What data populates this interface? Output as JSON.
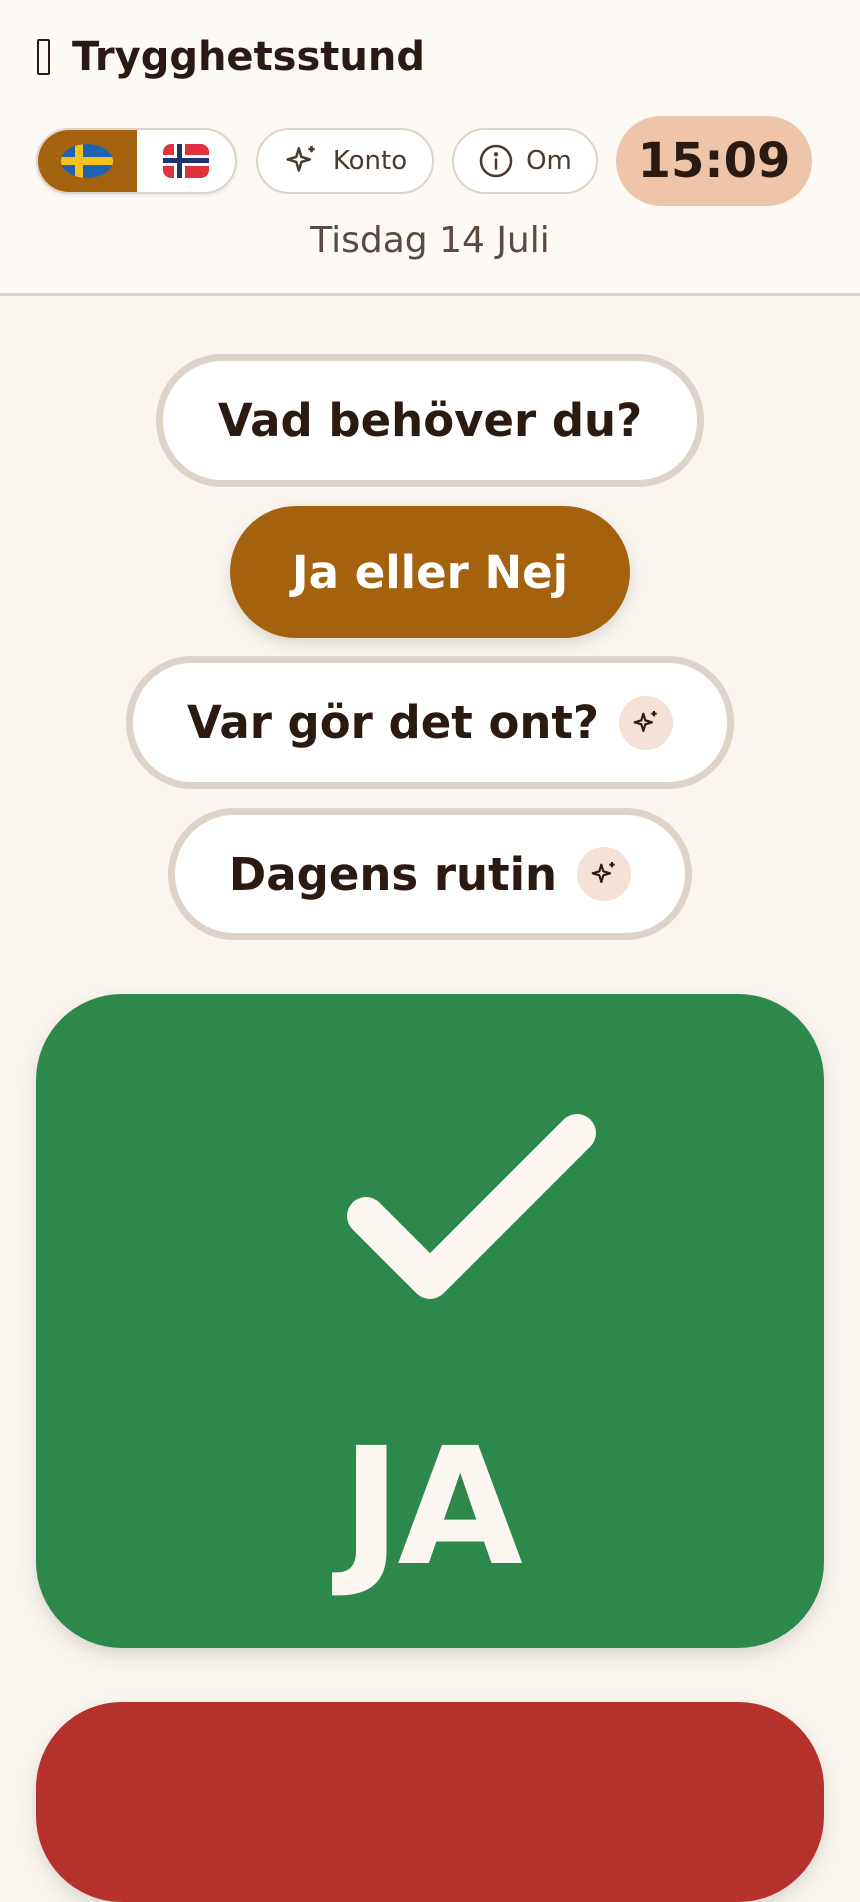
{
  "header": {
    "app_title": "Trygghetsstund",
    "languages": [
      {
        "code": "sv",
        "label": "Svenska",
        "active": true
      },
      {
        "code": "no",
        "label": "Norsk",
        "active": false
      }
    ],
    "account_label": "Konto",
    "about_label": "Om",
    "time": "15:09",
    "date": "Tisdag 14 Juli"
  },
  "modes": [
    {
      "label": "Vad behöver du?",
      "active": false,
      "ai": false
    },
    {
      "label": "Ja eller Nej",
      "active": true,
      "ai": false
    },
    {
      "label": "Var gör det ont?",
      "active": false,
      "ai": true
    },
    {
      "label": "Dagens rutin",
      "active": false,
      "ai": true
    }
  ],
  "answers": {
    "yes_label": "JA",
    "no_label": ""
  },
  "colors": {
    "accent": "#A4620F",
    "yes": "#2D894B",
    "no": "#B5312C",
    "clock_bg": "#EFC5AA",
    "background": "#FAF5EE"
  },
  "icons": {
    "title": "app-icon",
    "account": "sparkle-icon",
    "about": "info-icon",
    "yes": "check-icon",
    "ai_badge": "sparkle-icon"
  }
}
